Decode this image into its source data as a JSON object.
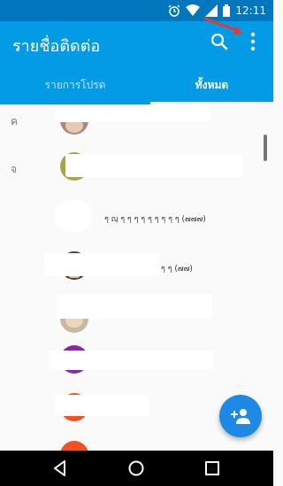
{
  "status_bar": {
    "time": "12:11"
  },
  "app_bar": {
    "title": "รายชื่อติดต่อ",
    "search_icon": "search-icon",
    "menu_icon": "more-vert-icon"
  },
  "tabs": [
    {
      "label": "รายการโปรด",
      "selected": false
    },
    {
      "label": "ทั้งหมด",
      "selected": true
    }
  ],
  "sections": [
    "ค",
    "จ"
  ],
  "contacts": [
    {
      "text": ""
    },
    {
      "text": ""
    },
    {
      "text": "ๆ ญฺ ๆ ๆ ๆ ๆ ๆ ๆ ๆ ๆ ๆ (๗๗๗)"
    },
    {
      "text": "ๆ ๆ (๗๗)"
    },
    {
      "text": ""
    },
    {
      "text": ""
    },
    {
      "text": ""
    },
    {
      "text": ""
    }
  ],
  "fab": {
    "icon": "add-contact-icon"
  },
  "nav": {
    "back": "back-icon",
    "home": "home-icon",
    "recents": "recents-icon"
  },
  "colors": {
    "primary": "#039be5",
    "status_bar": "#0277bd",
    "fab": "#1e88e5"
  }
}
